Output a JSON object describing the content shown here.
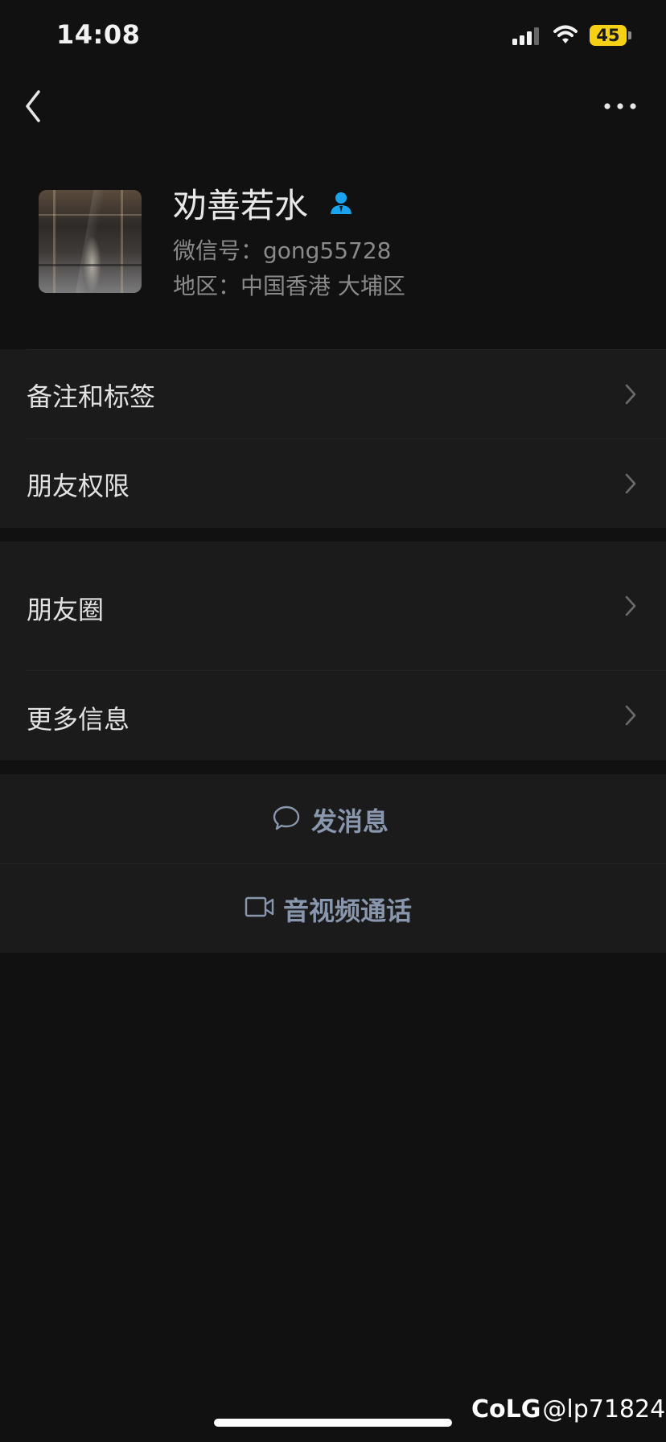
{
  "status_bar": {
    "time": "14:08",
    "battery_level": "45"
  },
  "profile": {
    "name": "劝善若水",
    "wechat_id": "微信号：gong55728",
    "region": "地区：中国香港 大埔区"
  },
  "menu": {
    "remarks_tags": "备注和标签",
    "friend_permissions": "朋友权限",
    "moments": "朋友圈",
    "more_info": "更多信息"
  },
  "actions": {
    "send_message": "发消息",
    "av_call": "音视频通话"
  },
  "watermark": {
    "brand": "CoLG",
    "handle": "@lp71824"
  },
  "colors": {
    "accent_blue": "#1aa4f0",
    "action_text": "#8897ad",
    "battery": "#f5d014"
  },
  "icons": [
    "chevron-left-icon",
    "more-dots-icon",
    "person-icon",
    "chevron-right-icon",
    "chat-bubble-icon",
    "video-camera-icon"
  ]
}
